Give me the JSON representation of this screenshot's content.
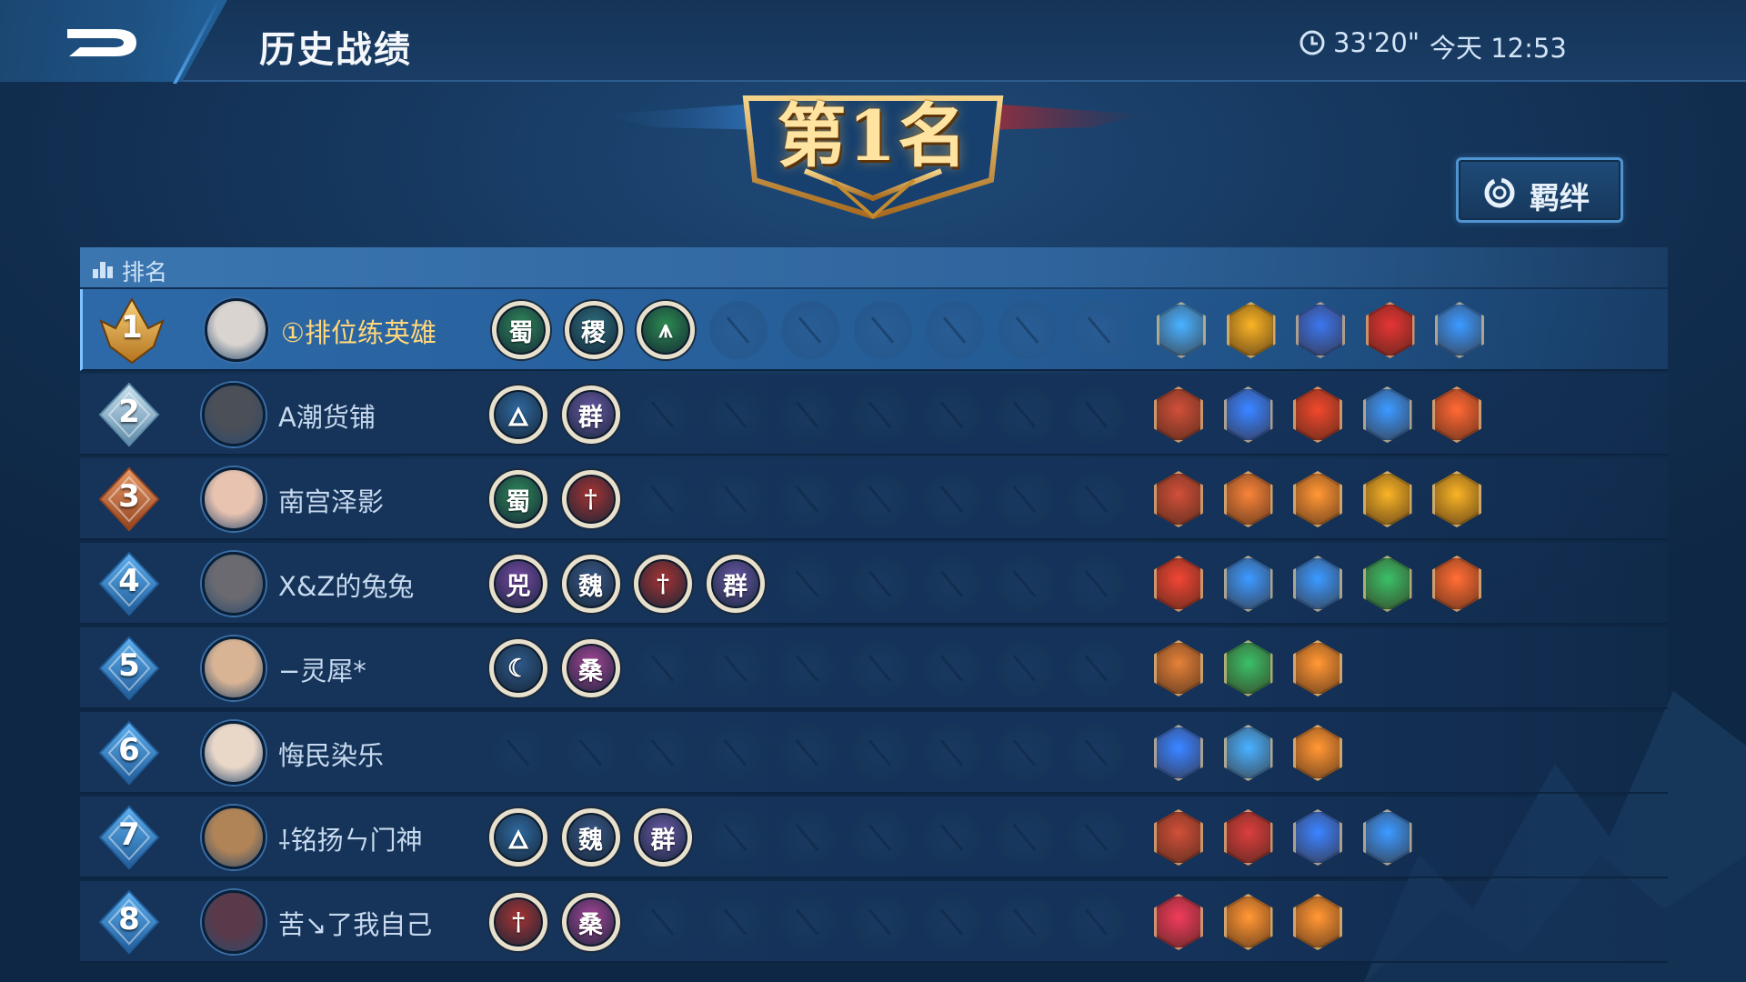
{
  "header": {
    "title": "历史战绩",
    "duration": "33'20\"",
    "datetime": "今天 12:53"
  },
  "result": {
    "placement": "第1名"
  },
  "bond_button": {
    "label": "羁绊"
  },
  "table": {
    "header_label": "排名"
  },
  "colors": {
    "gold": "#ffd77a",
    "selected_row": "#2d69a8",
    "row": "#163459",
    "bond_border": "#4f93d0"
  },
  "players": [
    {
      "rank": "1",
      "name": "①排位练英雄",
      "badge": "gold",
      "avatar_color": "#d9d4cf",
      "synergies": [
        {
          "glyph": "蜀",
          "color": "#2f8a5a"
        },
        {
          "glyph": "稷",
          "color": "#2d6f7e"
        },
        {
          "glyph": "⩚",
          "color": "#2c8c4f"
        }
      ],
      "items": [
        {
          "icon": "claw-ice-icon",
          "color": "#3a8fd0"
        },
        {
          "icon": "shield-gold-icon",
          "color": "#c8901e"
        },
        {
          "icon": "compass-icon",
          "color": "#2f5fc0"
        },
        {
          "icon": "blade-red-icon",
          "color": "#b92a2a"
        },
        {
          "icon": "claw-blue-icon",
          "color": "#2f7cd0"
        }
      ]
    },
    {
      "rank": "2",
      "name": "A潮货铺",
      "badge": "silver",
      "avatar_color": "#4a4f58",
      "synergies": [
        {
          "glyph": "🜂",
          "color": "#2f6aa0"
        },
        {
          "glyph": "群",
          "color": "#6b5aa8"
        }
      ],
      "items": [
        {
          "icon": "fist-icon",
          "color": "#a8402e"
        },
        {
          "icon": "blue-flame-icon",
          "color": "#2d6cd6"
        },
        {
          "icon": "red-dragon-icon",
          "color": "#c23a24"
        },
        {
          "icon": "claw-blue-icon",
          "color": "#2f7cd0"
        },
        {
          "icon": "fire-beast-icon",
          "color": "#d0542a"
        }
      ]
    },
    {
      "rank": "3",
      "name": "南宫泽影",
      "badge": "bronze",
      "avatar_color": "#e8c3b0",
      "synergies": [
        {
          "glyph": "蜀",
          "color": "#2f8a5a"
        },
        {
          "glyph": "†",
          "color": "#a83434"
        }
      ],
      "items": [
        {
          "icon": "fist-icon",
          "color": "#a8402e"
        },
        {
          "icon": "gold-coins-icon",
          "color": "#c86a2e"
        },
        {
          "icon": "gold-stack-icon",
          "color": "#d07a2a"
        },
        {
          "icon": "shield-gold-icon",
          "color": "#c8901e"
        },
        {
          "icon": "shield-gold-icon",
          "color": "#c8901e"
        }
      ]
    },
    {
      "rank": "4",
      "name": "X&Z的兔兔",
      "badge": "blue",
      "avatar_color": "#6a6a70",
      "synergies": [
        {
          "glyph": "兕",
          "color": "#7a4aa8"
        },
        {
          "glyph": "魏",
          "color": "#3a5a8a"
        },
        {
          "glyph": "†",
          "color": "#a83434"
        },
        {
          "glyph": "群",
          "color": "#6b5aa8"
        }
      ],
      "items": [
        {
          "icon": "red-blade-icon",
          "color": "#c2382a"
        },
        {
          "icon": "claw-blue-icon",
          "color": "#2f7cd0"
        },
        {
          "icon": "claw-blue-icon",
          "color": "#2f7cd0"
        },
        {
          "icon": "green-wind-icon",
          "color": "#2f9a54"
        },
        {
          "icon": "gold-s-icon",
          "color": "#d0582a"
        }
      ]
    },
    {
      "rank": "5",
      "name": "−灵犀*",
      "badge": "blue",
      "avatar_color": "#d8b494",
      "synergies": [
        {
          "glyph": "☾",
          "color": "#2f5a8a"
        },
        {
          "glyph": "桑",
          "color": "#a8469a"
        }
      ],
      "items": [
        {
          "icon": "fist-orange-icon",
          "color": "#b8682e"
        },
        {
          "icon": "green-wind-icon",
          "color": "#2f9a54"
        },
        {
          "icon": "gold-stack-icon",
          "color": "#d07a2a"
        }
      ]
    },
    {
      "rank": "6",
      "name": "悔民染乐",
      "badge": "blue",
      "avatar_color": "#e9d7c8",
      "synergies": [],
      "items": [
        {
          "icon": "blue-flame-icon",
          "color": "#2d6cd6"
        },
        {
          "icon": "claw-ice-icon",
          "color": "#3a8fd0"
        },
        {
          "icon": "gold-stack-icon",
          "color": "#d07a2a"
        }
      ]
    },
    {
      "rank": "7",
      "name": "⸸铭扬ㄣ门神",
      "badge": "blue",
      "avatar_color": "#b08456",
      "synergies": [
        {
          "glyph": "🜂",
          "color": "#2f6aa0"
        },
        {
          "glyph": "魏",
          "color": "#3a5a8a"
        },
        {
          "glyph": "群",
          "color": "#6b5aa8"
        }
      ],
      "items": [
        {
          "icon": "fist-icon",
          "color": "#a8402e"
        },
        {
          "icon": "jaws-icon",
          "color": "#b03232"
        },
        {
          "icon": "star-s-icon",
          "color": "#2f6ad0"
        },
        {
          "icon": "claw-blue-icon",
          "color": "#2f7cd0"
        }
      ]
    },
    {
      "rank": "8",
      "name": "苦↘了我自己",
      "badge": "blue",
      "avatar_color": "#5a3a4a",
      "synergies": [
        {
          "glyph": "†",
          "color": "#a83434"
        },
        {
          "glyph": "桑",
          "color": "#a8469a"
        }
      ],
      "items": [
        {
          "icon": "crimson-beast-icon",
          "color": "#c2304a"
        },
        {
          "icon": "gold-stack-icon",
          "color": "#d07a2a"
        },
        {
          "icon": "gold-stack-icon",
          "color": "#d07a2a"
        }
      ]
    }
  ]
}
